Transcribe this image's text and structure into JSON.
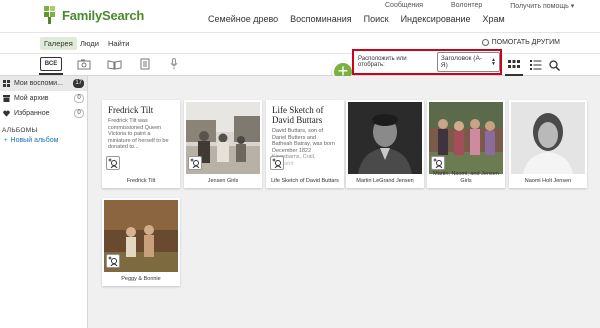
{
  "brand": {
    "name": "FamilySearch"
  },
  "utility_links": [
    "Сообщения",
    "Волонтер",
    "Получить помощь ▾"
  ],
  "main_nav": [
    "Семейное древо",
    "Воспоминания",
    "Поиск",
    "Индексирование",
    "Храм"
  ],
  "sub_nav": {
    "tabs": [
      "Галерея",
      "Люди",
      "Найти"
    ],
    "active": "Галерея",
    "help_others": "ПОМОГАТЬ ДРУГИМ"
  },
  "filters": {
    "all_label": "ВСЕ"
  },
  "sort": {
    "label": "Расположить или отобрать:",
    "selected": "Заголовок (А-Я)"
  },
  "sidebar": {
    "items": [
      {
        "label": "Мои воспоми...",
        "count": "17"
      },
      {
        "label": "Мой архив",
        "count": "0"
      },
      {
        "label": "Избранное",
        "count": "0"
      }
    ],
    "albums_heading": "АЛЬБОМЫ",
    "new_album": "Новый альбом"
  },
  "cards": [
    {
      "type": "document",
      "title": "Fredrick Tilt",
      "body": "Fredrick Tilt was commissioned Queen Victoria to paint a miniature of herself to be donated to...",
      "caption": "Fredrick Tilt"
    },
    {
      "type": "photo",
      "caption": "Jensen Girls"
    },
    {
      "type": "document",
      "title": "Life Sketch of David Buttars",
      "body": "David Buttars, son of Dariel Butters and Batheah Batray, was born December 1822 Kingsbarns, Crail, Scotland",
      "caption": "Life Sketch of David Buttars"
    },
    {
      "type": "photo",
      "caption": "Martin LeGrand Jensen"
    },
    {
      "type": "photo",
      "caption": "Martin, Naomi, and Jensen Girls"
    },
    {
      "type": "photo",
      "caption": "Naomi Holt Jensen"
    },
    {
      "type": "photo",
      "caption": "Peggy & Bonnie"
    }
  ],
  "colors": {
    "brand_green": "#7ab142",
    "highlight_red": "#d0021b",
    "link_blue": "#1a6fb5"
  }
}
